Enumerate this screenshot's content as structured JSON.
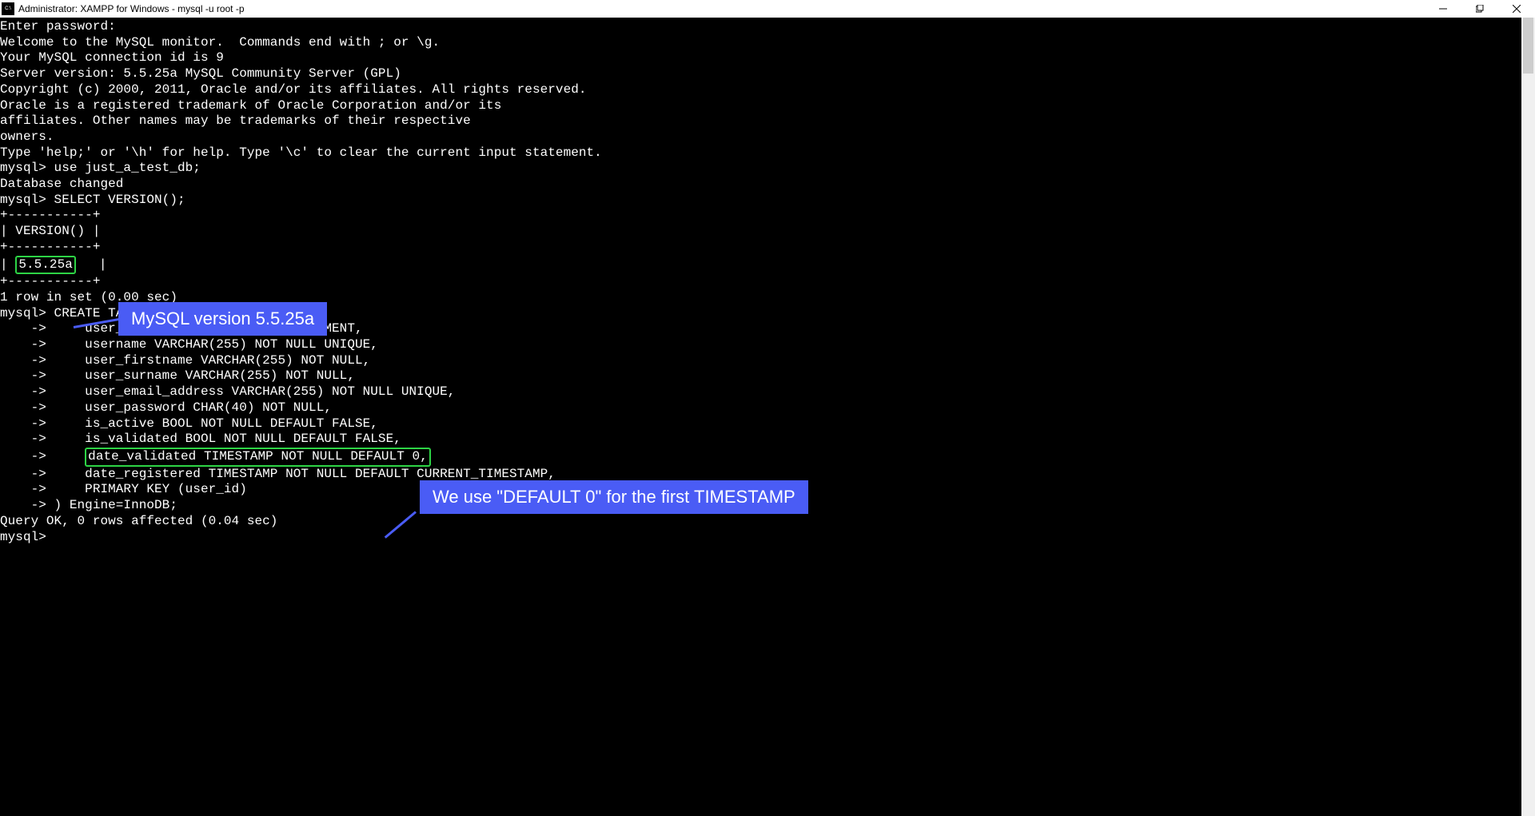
{
  "titlebar": {
    "title": "Administrator: XAMPP for Windows - mysql  -u root -p"
  },
  "terminal": {
    "l1": "Enter password:",
    "l2": "Welcome to the MySQL monitor.  Commands end with ; or \\g.",
    "l3": "Your MySQL connection id is 9",
    "l4": "Server version: 5.5.25a MySQL Community Server (GPL)",
    "l5": "",
    "l6": "Copyright (c) 2000, 2011, Oracle and/or its affiliates. All rights reserved.",
    "l7": "",
    "l8": "Oracle is a registered trademark of Oracle Corporation and/or its",
    "l9": "affiliates. Other names may be trademarks of their respective",
    "l10": "owners.",
    "l11": "",
    "l12": "Type 'help;' or '\\h' for help. Type '\\c' to clear the current input statement.",
    "l13": "",
    "l14": "mysql> use just_a_test_db;",
    "l15": "Database changed",
    "l16": "mysql> SELECT VERSION();",
    "l17": "+-----------+",
    "l18": "| VERSION() |",
    "l19": "+-----------+",
    "l20a": "| ",
    "l20b": "5.5.25a",
    "l20c": "   |",
    "l21": "+-----------+",
    "l22": "1 row in set (0.00 sec)",
    "l23": "",
    "l24": "mysql> CREATE TABLE site_users_2 (",
    "l25": "    ->     user_id INT NOT NULL AUTO_INCREMENT,",
    "l26": "    ->     username VARCHAR(255) NOT NULL UNIQUE,",
    "l27": "    ->     user_firstname VARCHAR(255) NOT NULL,",
    "l28": "    ->     user_surname VARCHAR(255) NOT NULL,",
    "l29": "    ->     user_email_address VARCHAR(255) NOT NULL UNIQUE,",
    "l30": "    ->     user_password CHAR(40) NOT NULL,",
    "l31": "    ->     is_active BOOL NOT NULL DEFAULT FALSE,",
    "l32": "    ->     is_validated BOOL NOT NULL DEFAULT FALSE,",
    "l33a": "    ->     ",
    "l33b": "date_validated TIMESTAMP NOT NULL DEFAULT 0,",
    "l34": "    ->     date_registered TIMESTAMP NOT NULL DEFAULT CURRENT_TIMESTAMP,",
    "l35": "    ->     PRIMARY KEY (user_id)",
    "l36": "    -> ) Engine=InnoDB;",
    "l37": "Query OK, 0 rows affected (0.04 sec)",
    "l38": "",
    "l39": "mysql>"
  },
  "callouts": {
    "c1": "MySQL version 5.5.25a",
    "c2": "We use \"DEFAULT 0\" for the first TIMESTAMP"
  }
}
